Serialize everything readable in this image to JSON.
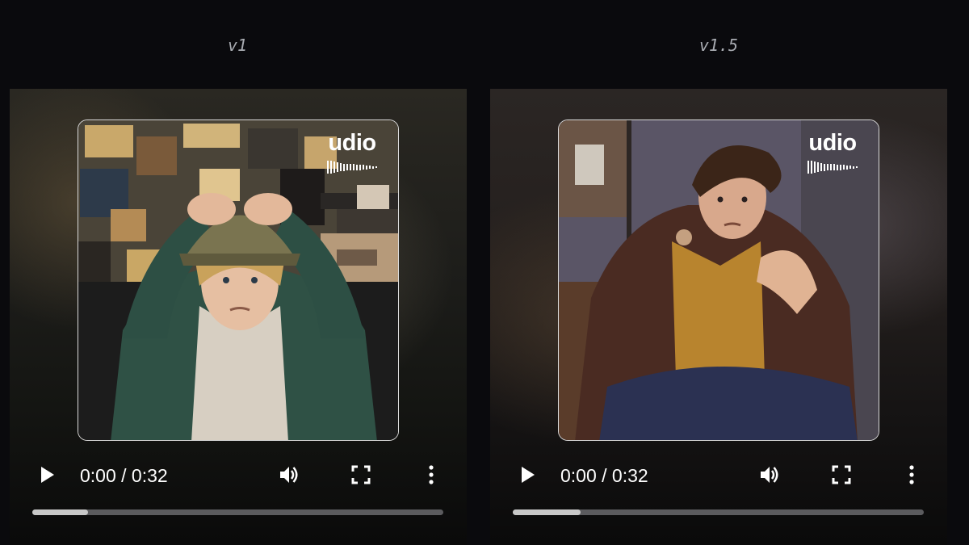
{
  "players": [
    {
      "version_label": "v1",
      "brand": "udio",
      "time_display": "0:00 / 0:32",
      "progress": 0.135,
      "controls": [
        "play-icon",
        "volume-icon",
        "fullscreen-icon",
        "more-options-icon"
      ]
    },
    {
      "version_label": "v1.5",
      "brand": "udio",
      "time_display": "0:00 / 0:32",
      "progress": 0.165,
      "controls": [
        "play-icon",
        "volume-icon",
        "fullscreen-icon",
        "more-options-icon"
      ]
    }
  ],
  "colors": {
    "page_background": "#0a0a0d",
    "label_text": "#a9acb2",
    "track": "#5b5b5e",
    "track_fill": "#c8c8c8",
    "control_icons": "#ffffff"
  }
}
